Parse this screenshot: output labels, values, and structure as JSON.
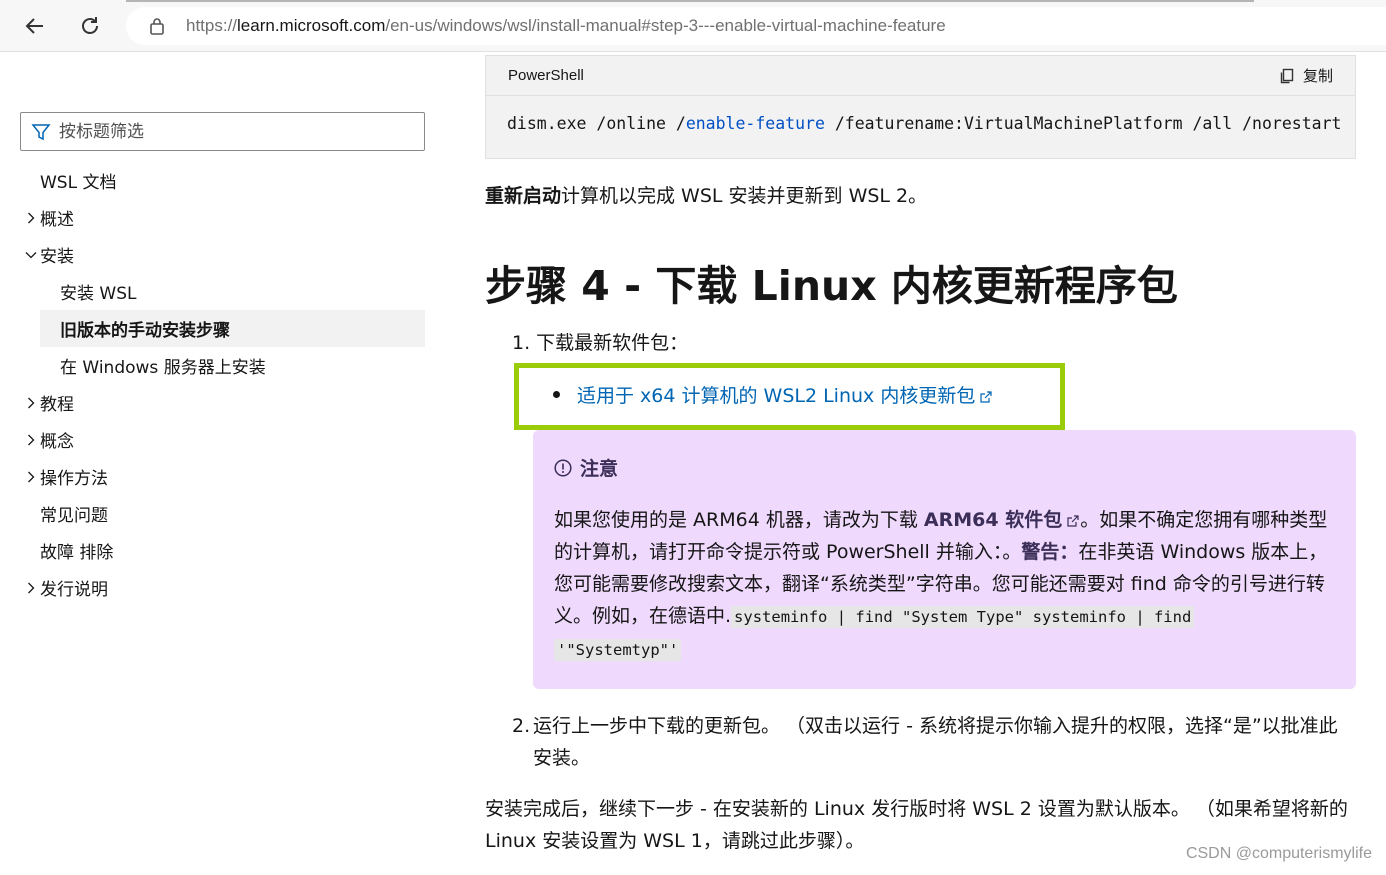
{
  "browser": {
    "url_prefix": "https://",
    "url_host": "learn.microsoft.com",
    "url_path": "/en-us/windows/wsl/install-manual#step-3---enable-virtual-machine-feature"
  },
  "sidebar": {
    "filter_placeholder": "按标题筛选",
    "items": [
      {
        "label": "WSL 文档",
        "chevron": "none",
        "level": 0
      },
      {
        "label": "概述",
        "chevron": "right",
        "level": 0
      },
      {
        "label": "安装",
        "chevron": "down",
        "level": 0
      },
      {
        "label": "安装 WSL",
        "chevron": "none",
        "level": 1
      },
      {
        "label": "旧版本的手动安装步骤",
        "chevron": "none",
        "level": 1,
        "active": true
      },
      {
        "label": "在 Windows 服务器上安装",
        "chevron": "none",
        "level": 1
      },
      {
        "label": "教程",
        "chevron": "right",
        "level": 0
      },
      {
        "label": "概念",
        "chevron": "right",
        "level": 0
      },
      {
        "label": "操作方法",
        "chevron": "right",
        "level": 0
      },
      {
        "label": "常见问题",
        "chevron": "none",
        "level": 0
      },
      {
        "label": "故障 排除",
        "chevron": "none",
        "level": 0
      },
      {
        "label": "发行说明",
        "chevron": "right",
        "level": 0
      }
    ]
  },
  "code_block": {
    "language": "PowerShell",
    "copy_label": "复制",
    "cmd_1": "dism.exe /online /",
    "cmd_kw": "enable-feature",
    "cmd_2": " /featurename:VirtualMachinePlatform /all /norestart"
  },
  "restart": {
    "bold": "重新启动",
    "rest": "计算机以完成 WSL 安装并更新到 WSL 2。"
  },
  "heading": "步骤 4 - 下载 Linux 内核更新程序包",
  "step1": {
    "label": "1. 下载最新软件包：",
    "link": "适用于 x64 计算机的 WSL2 Linux 内核更新包"
  },
  "note": {
    "title": "注意",
    "t1": "如果您使用的是 ARM64 机器，请改为下载 ",
    "link": "ARM64 软件包",
    "t2": "。如果不确定您拥有哪种类型的计算机，请打开命令提示符或 PowerShell 并输入：。",
    "warn": "警告：",
    "t3": "在非英语 Windows 版本上，您可能需要修改搜索文本，翻译“系统类型”字符串。您可能还需要对 find 命令的引号进行转义。例如，在德语中.",
    "code1": "systeminfo | find \"System Type\" systeminfo | find",
    "code2": "'\"Systemtyp\"'"
  },
  "step2": {
    "num": "2.",
    "text": "运行上一步中下载的更新包。 （双击以运行 - 系统将提示你输入提升的权限，选择“是”以批准此安装。"
  },
  "after": "安装完成后，继续下一步 - 在安装新的 Linux 发行版时将 WSL 2 设置为默认版本。 （如果希望将新的 Linux 安装设置为 WSL 1，请跳过此步骤）。",
  "watermark": "CSDN @computerismylife",
  "colors": {
    "highlight_border": "#9acc0a",
    "link": "#0065b3",
    "note_bg": "#efd9fd",
    "note_title": "#3b2e58"
  }
}
